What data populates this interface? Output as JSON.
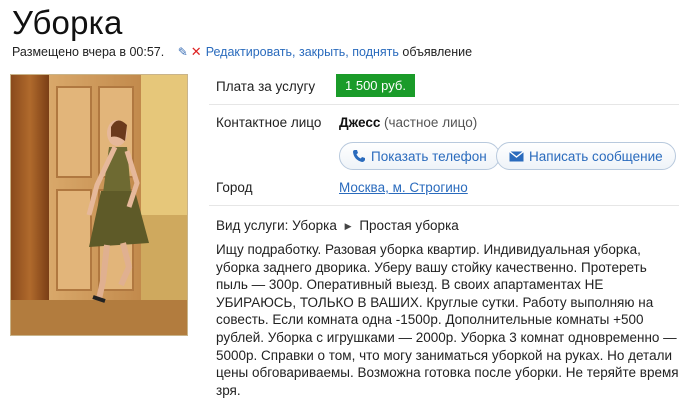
{
  "title": "Уборка",
  "meta": {
    "posted": "Размещено вчера в 00:57.",
    "actions_link": "Редактировать, закрыть, поднять",
    "actions_suffix": " объявление"
  },
  "price": {
    "label": "Плата за услугу",
    "value": "1 500 руб."
  },
  "contact": {
    "label": "Контактное лицо",
    "name": "Джесс",
    "type": "(частное лицо)",
    "show_phone": "Показать телефон",
    "send_message": "Написать сообщение"
  },
  "city": {
    "label": "Город",
    "value": "Москва, м. Строгино"
  },
  "service": {
    "label": "Вид услуги:",
    "category": "Уборка",
    "subcategory": "Простая уборка"
  },
  "description": "Ищу подработку. Разовая уборка квартир. Индивидуальная уборка, уборка заднего дворика. Уберу вашу стойку качественно. Протереть пыль — 300р. Оперативный выезд. В своих апартаментах НЕ УБИРАЮСЬ, ТОЛЬКО В ВАШИХ. Круглые сутки. Работу выполняю на совесть. Если комната одна -1500р. Дополнительные комнаты +500 рублей. Уборка с игрушками — 2000р. Уборка 3 комнат одновременно — 5000р. Справки о том, что могу заниматься уборкой на руках. Но детали цены обговариваемы. Возможна готовка после уборки. Не теряйте время зря.",
  "colors": {
    "link": "#2a6bbd",
    "price_bg": "#1a9b29"
  }
}
